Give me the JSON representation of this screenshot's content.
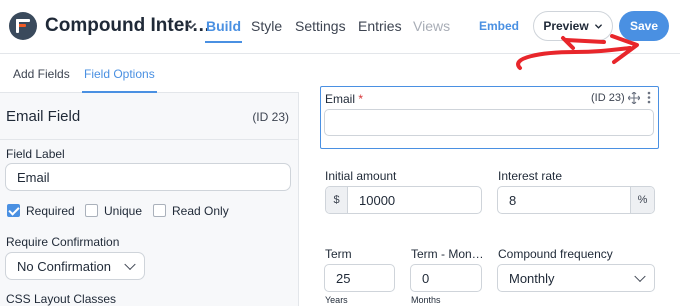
{
  "header": {
    "form_title": "Compound Inter…",
    "tabs": [
      {
        "label": "Build"
      },
      {
        "label": "Style"
      },
      {
        "label": "Settings"
      },
      {
        "label": "Entries"
      },
      {
        "label": "Views"
      }
    ],
    "embed_label": "Embed",
    "preview_label": "Preview",
    "save_label": "Save",
    "accent_color": "#4a90e2"
  },
  "sidebar": {
    "tabs": [
      {
        "label": "Add Fields"
      },
      {
        "label": "Field Options"
      }
    ],
    "field_name": "Email Field",
    "field_id": "(ID 23)",
    "field_label_title": "Field Label",
    "field_label_value": "Email",
    "checkboxes": [
      {
        "label": "Required",
        "checked": true
      },
      {
        "label": "Unique",
        "checked": false
      },
      {
        "label": "Read Only",
        "checked": false
      }
    ],
    "require_confirmation_title": "Require Confirmation",
    "require_confirmation_value": "No Confirmation",
    "css_layout_title": "CSS Layout Classes"
  },
  "canvas": {
    "email": {
      "label": "Email",
      "required_mark": "*",
      "id": "(ID 23)",
      "value": ""
    },
    "initial_amount": {
      "label": "Initial amount",
      "prefix": "$",
      "value": "10000"
    },
    "interest_rate": {
      "label": "Interest rate",
      "value": "8",
      "suffix": "%"
    },
    "term": {
      "label": "Term",
      "value": "25",
      "sublabel": "Years"
    },
    "term_months": {
      "label": "Term - Mon…",
      "value": "0",
      "sublabel": "Months"
    },
    "compound_frequency": {
      "label": "Compound frequency",
      "value": "Monthly"
    }
  }
}
